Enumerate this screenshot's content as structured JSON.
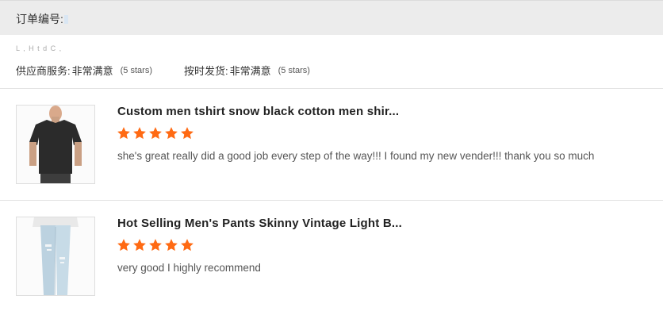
{
  "order": {
    "label": "订单编号:",
    "value": ""
  },
  "faint_text": "L      ,      H  t  d  C      ,",
  "ratings": [
    {
      "label": "供应商服务:",
      "value": "非常满意",
      "note": "(5 stars)"
    },
    {
      "label": "按时发货:",
      "value": "非常满意",
      "note": "(5 stars)"
    }
  ],
  "reviews": [
    {
      "title": "Custom men tshirt snow black cotton men shir...",
      "stars": 5,
      "comment": "she's great really did a good job every step of the way!!! I found my new vender!!! thank you so much",
      "image": "black-tshirt-product-photo"
    },
    {
      "title": "Hot Selling Men's Pants Skinny Vintage Light B...",
      "stars": 5,
      "comment": "very good I highly recommend",
      "image": "light-jeans-product-photo"
    }
  ],
  "colors": {
    "star": "#ff6a13",
    "header_bg": "#ececec",
    "divider": "#e3e3e3"
  }
}
